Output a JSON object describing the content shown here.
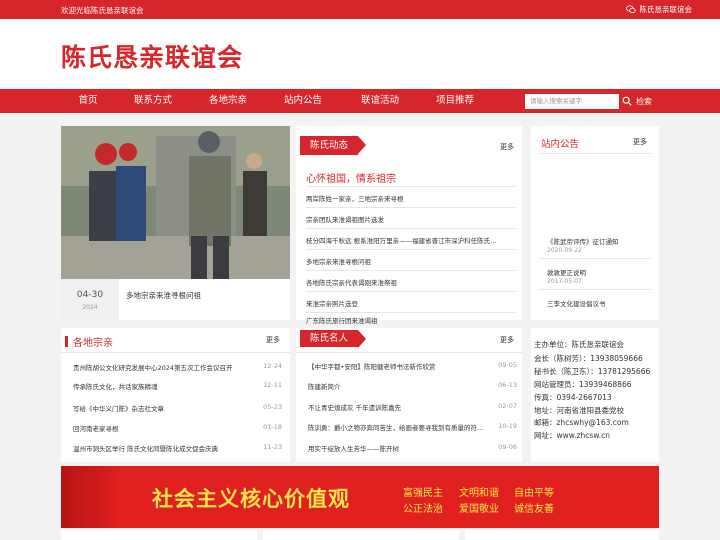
{
  "topbar": {
    "welcome": "欢迎光临陈氏恳亲联谊会",
    "wechat_label": "陈氏恳亲联谊会"
  },
  "header": {
    "site_name": "陈氏恳亲联谊会"
  },
  "nav": {
    "items": [
      "首页",
      "联系方式",
      "各地宗亲",
      "站内公告",
      "联谊活动",
      "项目推荐"
    ],
    "search_placeholder": "请输入搜索关键字",
    "search_label": "检索"
  },
  "feature": {
    "date_md": "04-30",
    "date_year": "2024",
    "title": "多地宗亲来淮寻根问祖"
  },
  "dongtai": {
    "title": "陈氏动态",
    "more": "更多",
    "headline": "心怀祖国，情系祖宗",
    "items": [
      "两岸陈姓一家亲，三地宗亲来寻根",
      "宗亲团队来淮谒祖图片选发",
      "枝分四海千秋远 根系淮阳万里亲——福建省晋江市深沪科任陈氏…",
      "多地宗亲来淮寻根问祖",
      "各地陈氏宗亲代表谒刚来淮祭祖",
      "来淮宗亲照片选登",
      "广东陈氏旅行团来淮谒祖"
    ]
  },
  "gonggao": {
    "title": "站内公告",
    "more": "更多",
    "items": [
      {
        "title": "《陈武帝评传》征订通知",
        "date": "2020-09-22"
      },
      {
        "title": "敦敦更正说明",
        "date": "2017-05-07"
      },
      {
        "title": "三李文化建设倡议书",
        "date": ""
      }
    ]
  },
  "zongqin": {
    "title": "各地宗亲",
    "more": "更多",
    "items": [
      {
        "title": "贵州陈胡公文化研究发展中心2024第五次工作会议召开",
        "date": "12-24"
      },
      {
        "title": "传承陈氏文化，共话家族精魂",
        "date": "12-11"
      },
      {
        "title": "写给《中华义门陈》杂志社文章",
        "date": "05-23"
      },
      {
        "title": "回河南老家寻根",
        "date": "01-18"
      },
      {
        "title": "温州市洞头区举行 陈氏文化同暨陈化成文促会庆典",
        "date": "11-23"
      }
    ]
  },
  "mingren": {
    "title": "陈氏名人",
    "more": "更多",
    "items": [
      {
        "title": "【中华字都•安阳】陈阳健老师书法新作欣赏",
        "date": "09-05"
      },
      {
        "title": "陈建新简介",
        "date": "06-13"
      },
      {
        "title": "不让青史熄成灰 千年遗训陈嘉先",
        "date": "02-07"
      },
      {
        "title": "陈训勇：爵小之物亦奔同苦生，给画者要寻我到有质量的符…",
        "date": "10-19"
      },
      {
        "title": "用实干绽放人生芳华——陈开树",
        "date": "09-06"
      }
    ]
  },
  "contact": {
    "lines": [
      "主办单位：陈氏恳亲联谊会",
      "会长（陈树芳）：13938059666",
      "秘书长（陈卫东）：13781295666",
      "网站管理员：13939468866",
      "传真：0394-2667013",
      "地址：河南省淮阳县委党校",
      "邮箱：zhcswhy@163.com",
      "网址：www.zhcsw.cn"
    ]
  },
  "banner": {
    "slogan": "社会主义核心价值观",
    "values": [
      "富强民主",
      "文明和谐",
      "自由平等",
      "公正法治",
      "爱国敬业",
      "诚信友善"
    ]
  },
  "colors": {
    "brand": "#d6262b",
    "banner_text": "#ffe34d"
  }
}
